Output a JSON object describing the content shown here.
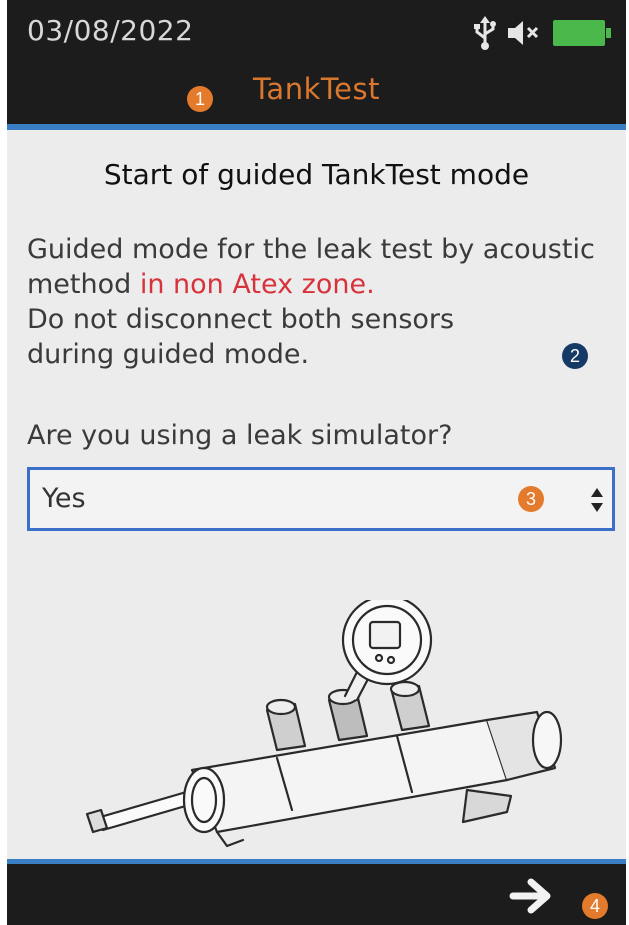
{
  "status_bar": {
    "date": "03/08/2022",
    "icons": [
      "usb-icon",
      "speaker-muted-icon",
      "battery-icon"
    ],
    "battery_color": "#4ab84a"
  },
  "header": {
    "title": "TankTest",
    "title_color": "#d9772e",
    "rule_color": "#3a7fc4"
  },
  "content": {
    "title": "Start of guided TankTest mode",
    "description_part1": "Guided mode for the leak test by acoustic method ",
    "description_highlight": "in non Atex zone.",
    "description_part2": "Do not disconnect both sensors during guided mode.",
    "highlight_color": "#d6333d",
    "question": "Are you using a leak simulator?",
    "select": {
      "value": "Yes",
      "icon": "up-down-stepper-icon",
      "border_color": "#3b70c9"
    },
    "illustration": "leak-simulator-illustration"
  },
  "footer": {
    "next_icon": "arrow-right-icon"
  },
  "annotations": {
    "callout_1": "1",
    "callout_2": "2",
    "callout_3": "3",
    "callout_4": "4"
  }
}
